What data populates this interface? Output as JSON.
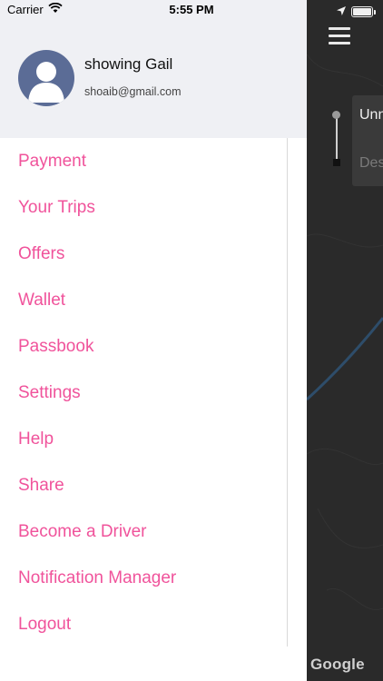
{
  "status_bar": {
    "carrier": "Carrier",
    "time": "5:55 PM"
  },
  "profile": {
    "name": "showing Gail",
    "email": "shoaib@gmail.com"
  },
  "menu": {
    "items": [
      {
        "label": "Payment"
      },
      {
        "label": "Your Trips"
      },
      {
        "label": "Offers"
      },
      {
        "label": "Wallet"
      },
      {
        "label": "Passbook"
      },
      {
        "label": "Settings"
      },
      {
        "label": "Help"
      },
      {
        "label": "Share"
      },
      {
        "label": "Become a Driver"
      },
      {
        "label": "Notification Manager"
      },
      {
        "label": "Logout"
      }
    ]
  },
  "map": {
    "route_from": "Unn",
    "route_to": "Des",
    "attribution": "Google"
  },
  "colors": {
    "accent": "#f0539b",
    "header_bg": "#eff0f4",
    "avatar_bg": "#5b6c96",
    "map_bg": "#2a2a2a"
  },
  "icons": [
    "wifi-icon",
    "location-arrow-icon",
    "battery-icon",
    "menu-icon",
    "avatar-icon"
  ]
}
